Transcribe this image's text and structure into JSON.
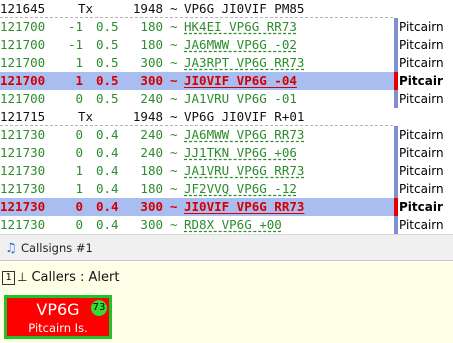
{
  "log": {
    "rows": [
      {
        "kind": "head",
        "time": "121645",
        "mode": "Tx",
        "freq": "1948",
        "sep": "~",
        "msg": "VP6G JI0VIF PM85"
      },
      {
        "kind": "rx",
        "time": "121700",
        "db": "-1",
        "dt": "0.5",
        "freq": "180",
        "sep": "~",
        "msg": "HK4EI VP6G RR73",
        "country": "Pitcairn"
      },
      {
        "kind": "rx",
        "time": "121700",
        "db": "-1",
        "dt": "0.5",
        "freq": "180",
        "sep": "~",
        "msg": "JA6MWW VP6G -02",
        "country": "Pitcairn"
      },
      {
        "kind": "rx",
        "time": "121700",
        "db": "1",
        "dt": "0.5",
        "freq": "300",
        "sep": "~",
        "msg": "JA3RPT VP6G RR73",
        "country": "Pitcairn"
      },
      {
        "kind": "hl",
        "time": "121700",
        "db": "1",
        "dt": "0.5",
        "freq": "300",
        "sep": "~",
        "msg": "JI0VIF VP6G -04",
        "country": "Pitcair"
      },
      {
        "kind": "plain",
        "time": "121700",
        "db": "0",
        "dt": "0.5",
        "freq": "240",
        "sep": "~",
        "msg": "JA1VRU VP6G -01",
        "country": "Pitcairn"
      },
      {
        "kind": "head",
        "time": "121715",
        "mode": "Tx",
        "freq": "1948",
        "sep": "~",
        "msg": "VP6G JI0VIF R+01"
      },
      {
        "kind": "rx",
        "time": "121730",
        "db": "0",
        "dt": "0.4",
        "freq": "240",
        "sep": "~",
        "msg": "JA6MWW VP6G RR73",
        "country": "Pitcairn"
      },
      {
        "kind": "rx",
        "time": "121730",
        "db": "0",
        "dt": "0.4",
        "freq": "240",
        "sep": "~",
        "msg": "JJ1TKN VP6G +06",
        "country": "Pitcairn"
      },
      {
        "kind": "rx",
        "time": "121730",
        "db": "1",
        "dt": "0.4",
        "freq": "180",
        "sep": "~",
        "msg": "JA1VRU VP6G RR73",
        "country": "Pitcairn"
      },
      {
        "kind": "rx",
        "time": "121730",
        "db": "1",
        "dt": "0.4",
        "freq": "180",
        "sep": "~",
        "msg": "JF2VVQ VP6G -12",
        "country": "Pitcairn"
      },
      {
        "kind": "hl",
        "time": "121730",
        "db": "0",
        "dt": "0.4",
        "freq": "300",
        "sep": "~",
        "msg": "JI0VIF VP6G RR73",
        "country": "Pitcair"
      },
      {
        "kind": "rx",
        "time": "121730",
        "db": "0",
        "dt": "0.4",
        "freq": "300",
        "sep": "~",
        "msg": "RD8X VP6G +00",
        "country": "Pitcairn"
      }
    ]
  },
  "tabs": {
    "active_label": "Callsigns #1",
    "icon": "music-note-icon"
  },
  "callers": {
    "pane_number": "1",
    "pin_icon": "pin-icon",
    "title": "Callers : Alert",
    "card": {
      "call": "VP6G",
      "country": "Pitcairn Is.",
      "badge": "73",
      "bg_color": "#ff0000",
      "border_color": "#22c32a"
    }
  },
  "colors": {
    "rx_text": "#2e8b2e",
    "highlight_bg": "#a9bdf0",
    "highlight_text": "#d40000",
    "country_bar": "#7f8fd0",
    "country_bar_alert": "#e60000"
  }
}
